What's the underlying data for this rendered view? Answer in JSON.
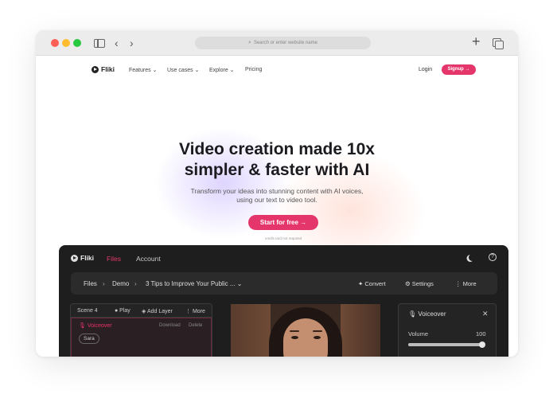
{
  "browser": {
    "address_placeholder": "Search or enter website name",
    "icons": [
      "sidebar-icon",
      "back-icon",
      "forward-icon",
      "search-icon",
      "new-tab-icon",
      "tabs-overview-icon"
    ]
  },
  "site": {
    "logo_text": "Fliki",
    "nav": {
      "features": "Features ⌄",
      "use_cases": "Use cases ⌄",
      "explore": "Explore ⌄",
      "pricing": "Pricing"
    },
    "login": "Login",
    "signup": "Signup →"
  },
  "hero": {
    "title_line1": "Video creation made 10x",
    "title_line2": "simpler & faster with AI",
    "subtitle": "Transform your ideas into stunning content with AI voices, using our text to video tool.",
    "cta": "Start for free →",
    "cta_note": "credit card not required"
  },
  "app": {
    "logo_text": "Fliki",
    "tabs": {
      "files": "Files",
      "account": "Account"
    },
    "breadcrumb": {
      "files": "Files",
      "demo": "Demo",
      "project": "3 Tips to Improve Your Public ...",
      "separator": "›"
    },
    "actions": {
      "convert": "✦ Convert",
      "settings": "⚙ Settings",
      "more": "⋮ More"
    },
    "scene": {
      "title": "Scene 4",
      "play": "● Play",
      "add_layer": "◈ Add Layer",
      "more": "⋮ More",
      "voiceover_label": "🎙 Voiceover",
      "download": "Download",
      "delete": "Delete",
      "voice_name": "Sara"
    },
    "voiceover_panel": {
      "title": "🎙 Voiceover",
      "close": "✕",
      "volume_label": "Volume",
      "volume_value": "100",
      "volume_fraction": 1.0
    },
    "colors": {
      "accent": "#e5366b",
      "dark_bg": "#1e1e1e"
    }
  }
}
